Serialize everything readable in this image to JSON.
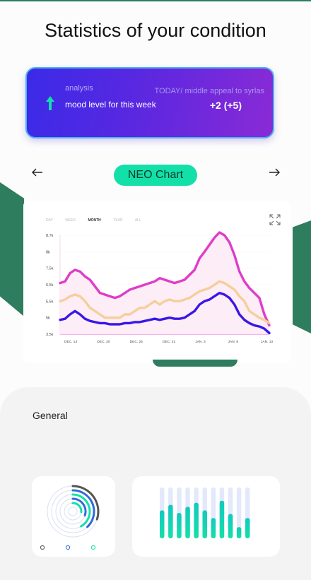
{
  "header": {
    "title": "Statistics of your condition"
  },
  "analysis": {
    "label": "analysis",
    "mood_text": "mood level for this week",
    "today_text": "TODAY/ middle appeal to syrlas",
    "value": "+2 (+5)",
    "arrow_icon": "arrow-up-icon",
    "arrow_color": "#13e0a8"
  },
  "nav": {
    "prev_icon": "arrow-left-icon",
    "next_icon": "arrow-right-icon",
    "chart_label": "NEO Chart"
  },
  "chart_tabs": [
    "DAY",
    "WEEK",
    "MONTH",
    "YEAR",
    "ALL"
  ],
  "chart_tabs_active": "MONTH",
  "chart_data": {
    "type": "line",
    "y_ticks": [
      "8.7k",
      "8k",
      "7.5k",
      "6.5k",
      "5.5k",
      "5k",
      "3.5k"
    ],
    "x_ticks": [
      "DEC. 13",
      "DEC. 20",
      "DEC. 25",
      "DEC. 31",
      "JAN. 3",
      "JAN. 8",
      "JAN. 13"
    ],
    "series": [
      {
        "color": "#e03cc8",
        "values": [
          6.6,
          6.7,
          7.2,
          7.4,
          7.3,
          7.0,
          6.8,
          6.4,
          6.0,
          5.9,
          5.8,
          5.7,
          5.8,
          6.0,
          6.2,
          6.3,
          6.4,
          6.5,
          6.6,
          6.7,
          6.9,
          6.8,
          6.7,
          6.6,
          6.7,
          6.8,
          7.1,
          7.4,
          7.8,
          8.0,
          8.3,
          8.6,
          8.9,
          8.7,
          8.4,
          7.9,
          7.3,
          6.7,
          6.3,
          6.0,
          5.7,
          5.1,
          4.3
        ]
      },
      {
        "color": "#f5cf9a",
        "values": [
          5.5,
          5.6,
          5.8,
          5.9,
          5.8,
          5.5,
          5.3,
          5.2,
          5.1,
          5.0,
          5.0,
          5.0,
          5.0,
          5.1,
          5.1,
          5.2,
          5.3,
          5.3,
          5.4,
          5.5,
          5.4,
          5.5,
          5.6,
          5.5,
          5.5,
          5.6,
          5.7,
          5.9,
          6.1,
          6.2,
          6.3,
          6.5,
          6.7,
          6.6,
          6.4,
          6.2,
          5.8,
          5.5,
          5.2,
          5.1,
          5.0,
          4.8,
          4.5
        ]
      },
      {
        "color": "#3a17e6",
        "values": [
          4.8,
          4.9,
          5.1,
          5.2,
          5.1,
          4.9,
          4.7,
          4.6,
          4.5,
          4.5,
          4.4,
          4.4,
          4.4,
          4.5,
          4.5,
          4.6,
          4.6,
          4.7,
          4.8,
          4.9,
          4.8,
          4.9,
          5.0,
          4.9,
          4.9,
          5.0,
          5.1,
          5.2,
          5.4,
          5.5,
          5.6,
          5.8,
          6.0,
          5.9,
          5.7,
          5.4,
          5.1,
          4.8,
          4.5,
          4.3,
          4.2,
          4.0,
          3.6
        ]
      }
    ]
  },
  "general": {
    "title": "General",
    "rings": {
      "arcs": [
        {
          "color": "#555",
          "fraction": 0.3
        },
        {
          "color": "#2e6bd6",
          "fraction": 0.38
        },
        {
          "color": "#13e0a8",
          "fraction": 0.42
        },
        {
          "color": "#2e6bd6",
          "fraction": 0.3
        },
        {
          "color": "#13e0a8",
          "fraction": 0.26
        },
        {
          "color": "#cfd8ea",
          "fraction": 0.0
        }
      ],
      "legend_colors": [
        "#555555",
        "#2e6bd6",
        "#13e0a8"
      ]
    },
    "bars": {
      "values": [
        0.55,
        0.66,
        0.5,
        0.62,
        0.7,
        0.55,
        0.4,
        0.74,
        0.48,
        0.22,
        0.4
      ],
      "track_color": "#e3e9fb",
      "fill_colors": [
        "#13e0a8",
        "#13c9c0"
      ]
    }
  }
}
